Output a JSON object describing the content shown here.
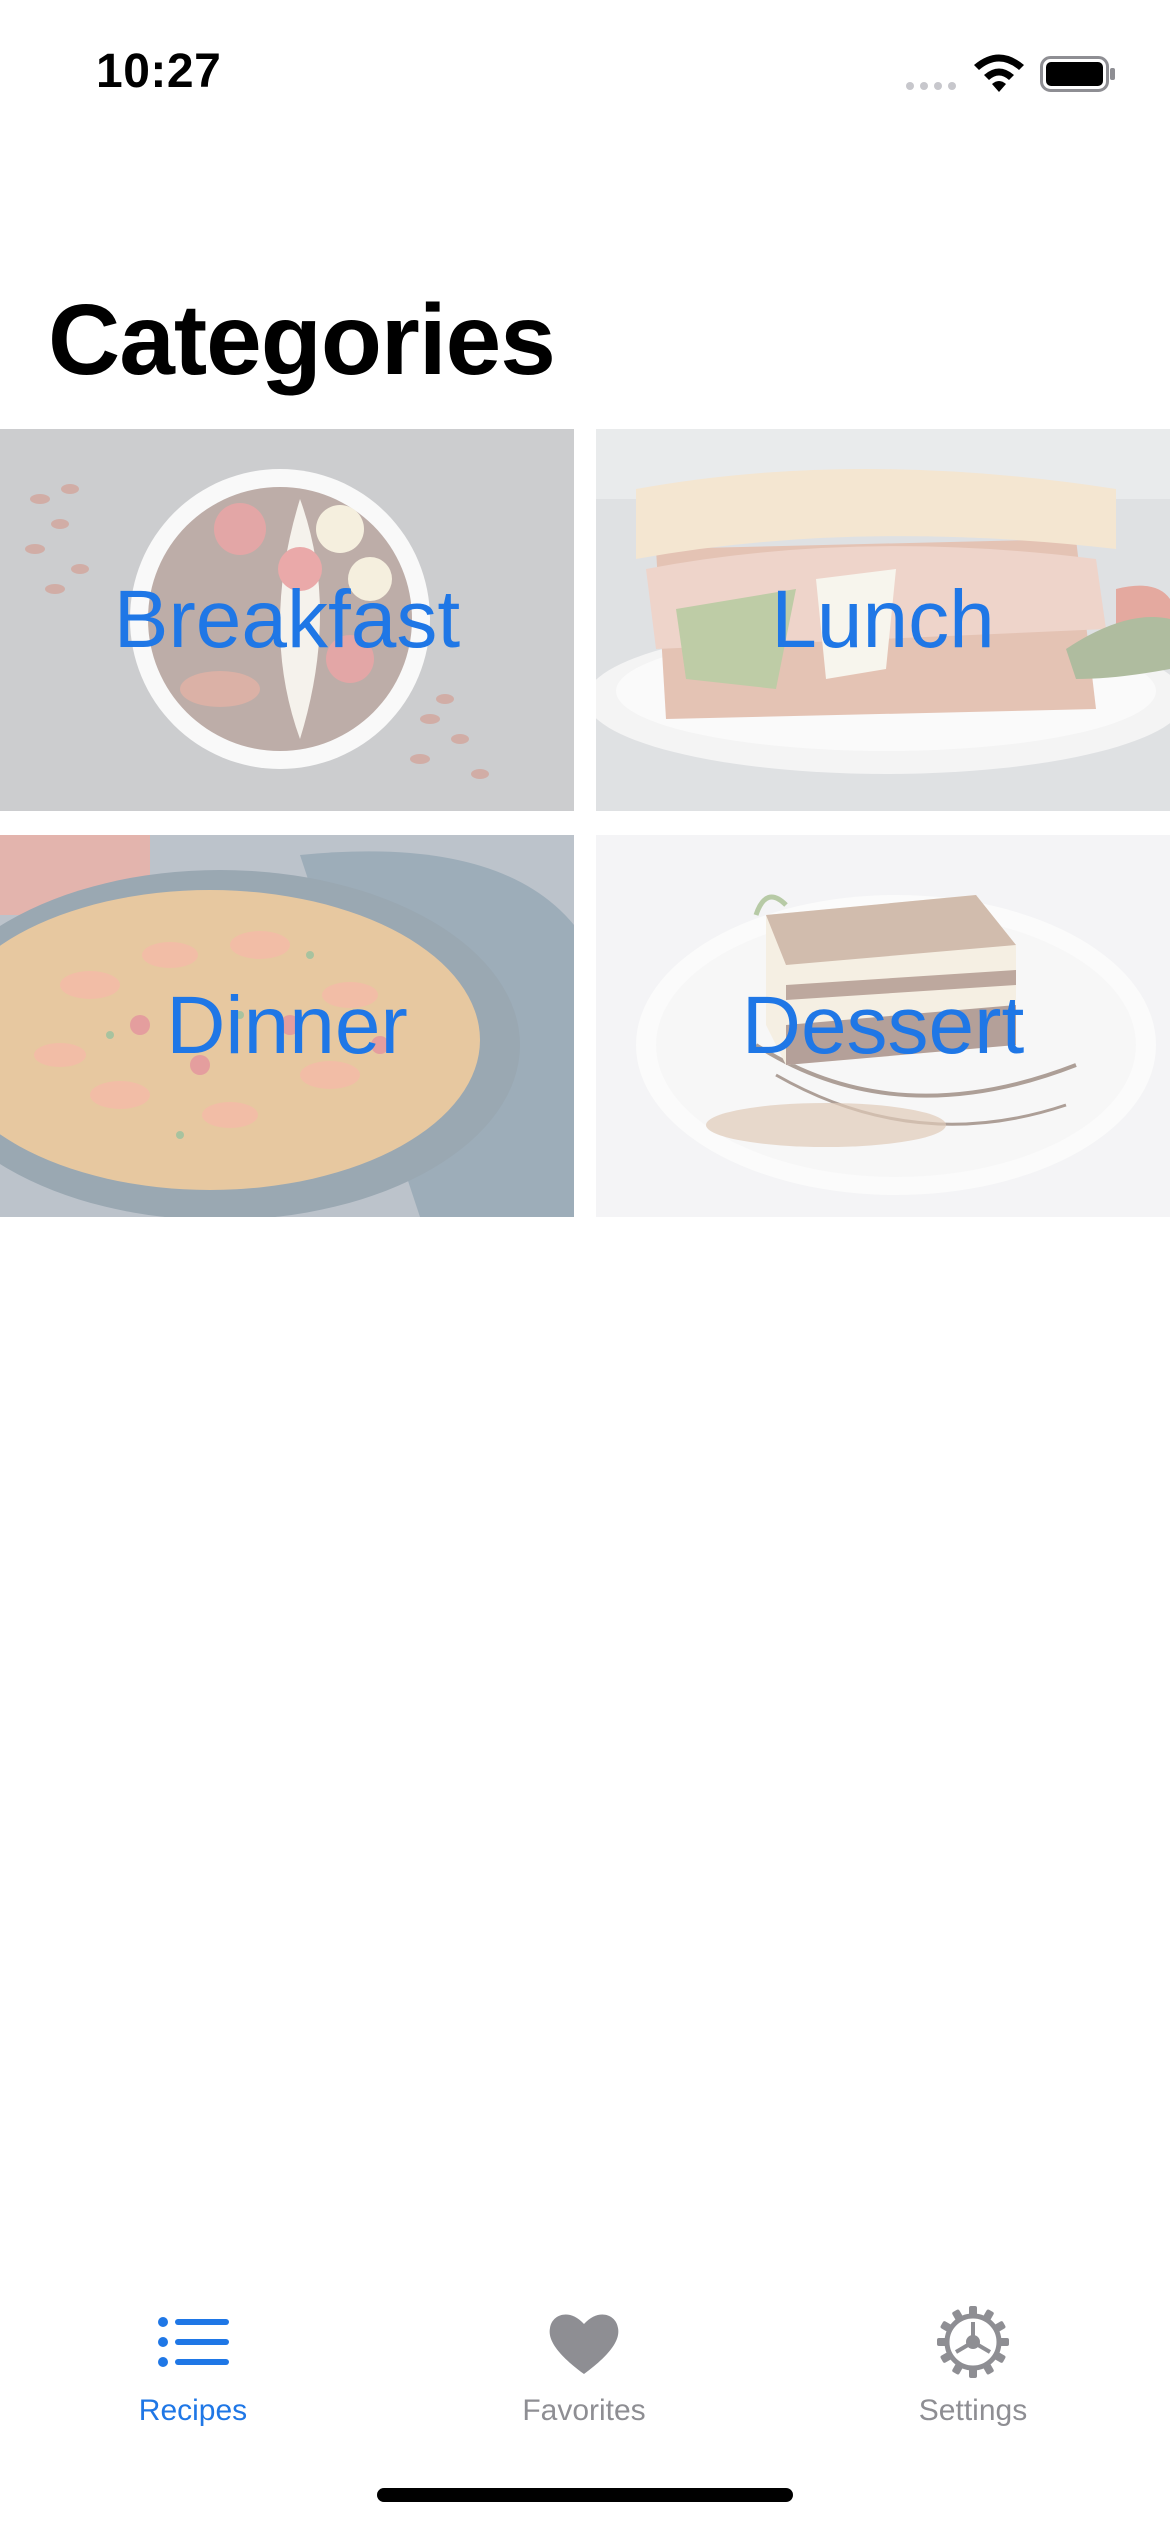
{
  "status_bar": {
    "time": "10:27"
  },
  "page": {
    "title": "Categories"
  },
  "categories": [
    {
      "label": "Breakfast",
      "image": "fruit-bowl-image"
    },
    {
      "label": "Lunch",
      "image": "sandwich-image"
    },
    {
      "label": "Dinner",
      "image": "paella-image"
    },
    {
      "label": "Dessert",
      "image": "cake-slice-image"
    }
  ],
  "tab_bar": {
    "items": [
      {
        "label": "Recipes",
        "icon": "list-icon",
        "selected": true
      },
      {
        "label": "Favorites",
        "icon": "heart-icon",
        "selected": false
      },
      {
        "label": "Settings",
        "icon": "gear-icon",
        "selected": false
      }
    ]
  },
  "colors": {
    "accent": "#1f77e6",
    "inactive": "#8e8e93",
    "background": "#ffffff",
    "title": "#000000"
  }
}
